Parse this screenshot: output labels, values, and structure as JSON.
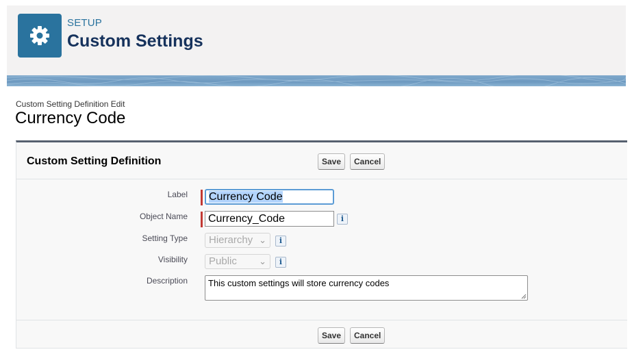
{
  "header": {
    "section_label": "SETUP",
    "title": "Custom Settings",
    "icon": "gear-icon",
    "accent_color": "#2a739e"
  },
  "page": {
    "subtitle": "Custom Setting Definition Edit",
    "title": "Currency Code"
  },
  "panel": {
    "title": "Custom Setting Definition",
    "save_label": "Save",
    "cancel_label": "Cancel"
  },
  "form": {
    "label": {
      "label": "Label",
      "value": "Currency Code",
      "required": true
    },
    "object_name": {
      "label": "Object Name",
      "value": "Currency_Code",
      "required": true
    },
    "setting_type": {
      "label": "Setting Type",
      "value": "Hierarchy",
      "disabled": true
    },
    "visibility": {
      "label": "Visibility",
      "value": "Public",
      "disabled": true
    },
    "description": {
      "label": "Description",
      "value": "This custom settings will store currency codes"
    },
    "info_glyph": "i"
  },
  "colors": {
    "required_marker": "#c23934",
    "focus_ring": "#5b9bd5",
    "panel_border_top": "#56606f"
  }
}
